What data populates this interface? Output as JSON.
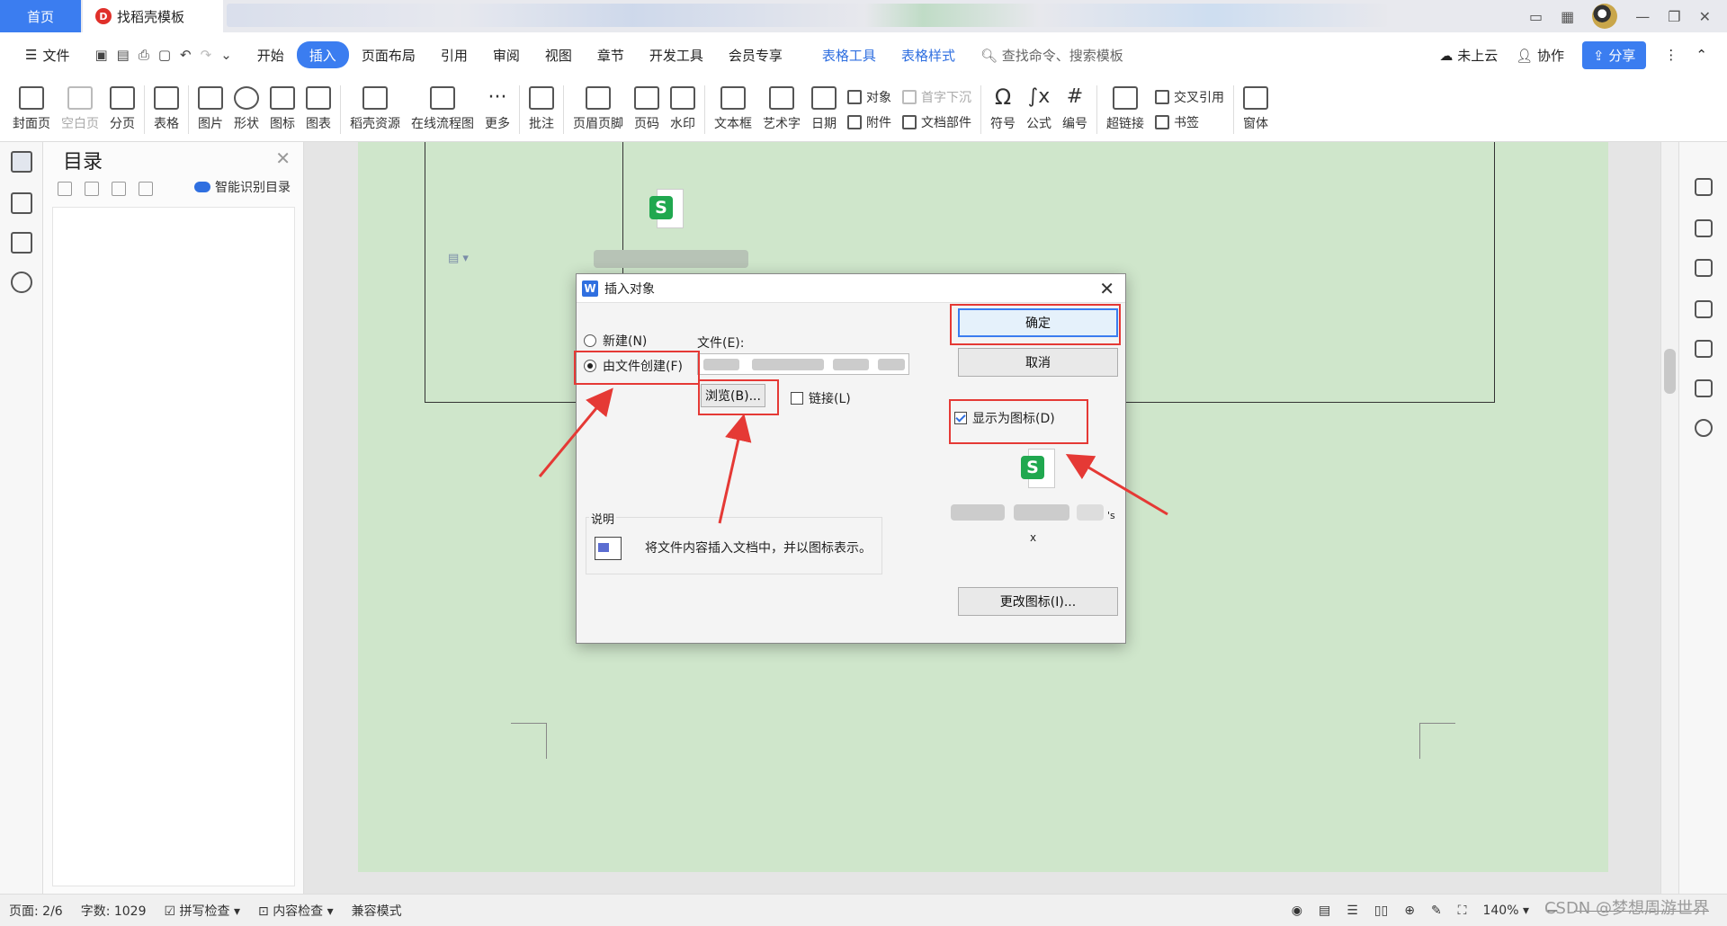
{
  "tabs": {
    "home": "首页",
    "doc": "找稻壳模板"
  },
  "menu": {
    "file": "文件",
    "items": [
      "开始",
      "插入",
      "页面布局",
      "引用",
      "审阅",
      "视图",
      "章节",
      "开发工具",
      "会员专享"
    ],
    "context_items": [
      "表格工具",
      "表格样式"
    ],
    "search": "查找命令、搜索模板",
    "cloud": "未上云",
    "collab": "协作",
    "share": "分享"
  },
  "ribbon": {
    "cover": "封面页",
    "blank": "空白页",
    "pagebreak": "分页",
    "table": "表格",
    "picture": "图片",
    "shape": "形状",
    "icon": "图标",
    "chart": "图表",
    "docer": "稻壳资源",
    "flowchart": "在线流程图",
    "more": "更多",
    "comment": "批注",
    "header_footer": "页眉页脚",
    "pagenum": "页码",
    "watermark": "水印",
    "textbox": "文本框",
    "wordart": "艺术字",
    "date": "日期",
    "object": "对象",
    "attachment": "附件",
    "dropcap": "首字下沉",
    "docparts": "文档部件",
    "symbol": "符号",
    "formula": "公式",
    "numbering": "编号",
    "hyperlink": "超链接",
    "crossref": "交叉引用",
    "bookmark": "书签",
    "window": "窗体"
  },
  "toc": {
    "title": "目录",
    "smart": "智能识别目录"
  },
  "dialog": {
    "title": "插入对象",
    "new_label": "新建(N)",
    "from_file_label": "由文件创建(F)",
    "file_label": "文件(E):",
    "browse": "浏览(B)...",
    "link": "链接(L)",
    "ok": "确定",
    "cancel": "取消",
    "display_as_icon": "显示为图标(D)",
    "preview_caption_end": "'s",
    "preview_ext": "x",
    "description_label": "说明",
    "description": "将文件内容插入文档中，并以图标表示。",
    "change_icon": "更改图标(I)...",
    "selected": "from_file",
    "link_checked": false,
    "icon_checked": true
  },
  "status": {
    "page": "页面: 2/6",
    "words": "字数: 1029",
    "spell": "拼写检查",
    "content": "内容检查",
    "compat": "兼容模式",
    "zoom": "140%"
  },
  "watermark": "CSDN @梦想周游世界",
  "colors": {
    "accent": "#3b7df0",
    "highlight": "#e53935",
    "page": "#cfe6cb",
    "et_green": "#20a84f"
  }
}
